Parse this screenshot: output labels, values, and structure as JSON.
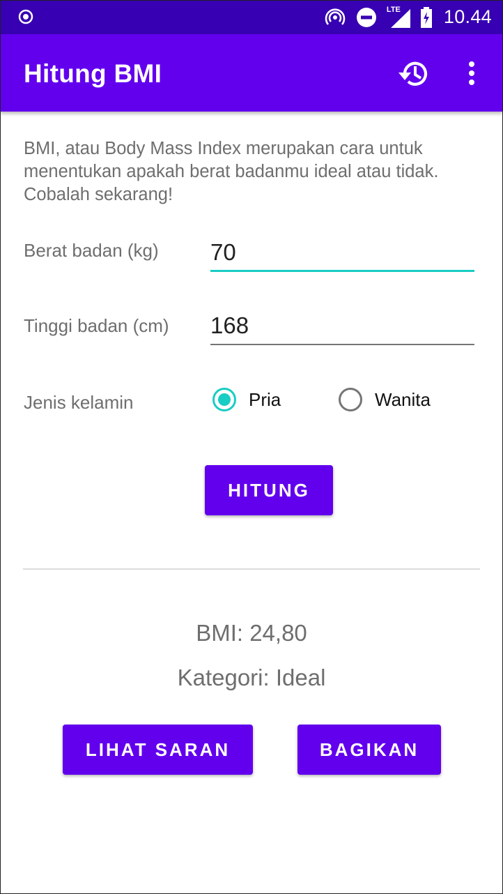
{
  "status_bar": {
    "time": "10.44",
    "network_label": "LTE",
    "icons": [
      "radio-target-icon",
      "hotspot-icon",
      "do-not-disturb-icon",
      "signal-lte-icon",
      "battery-charging-icon"
    ]
  },
  "app_bar": {
    "title": "Hitung BMI",
    "actions": [
      "history-icon",
      "more-vert-icon"
    ],
    "color": "#6200ee",
    "status_color": "#3700b3"
  },
  "intro_text": "BMI, atau Body Mass Index merupakan cara untuk menentukan apakah berat badanmu ideal atau tidak. Cobalah sekarang!",
  "form": {
    "weight": {
      "label": "Berat badan (kg)",
      "value": "70",
      "focused": true
    },
    "height": {
      "label": "Tinggi badan (cm)",
      "value": "168",
      "focused": false
    },
    "gender": {
      "label": "Jenis kelamin",
      "options": [
        {
          "label": "Pria",
          "checked": true
        },
        {
          "label": "Wanita",
          "checked": false
        }
      ]
    },
    "calculate_label": "HITUNG"
  },
  "result": {
    "bmi": "BMI: 24,80",
    "category": "Kategori: Ideal"
  },
  "actions": {
    "advice_label": "LIHAT SARAN",
    "share_label": "BAGIKAN"
  },
  "colors": {
    "accent": "#18cdc3",
    "primary": "#6200ee"
  }
}
